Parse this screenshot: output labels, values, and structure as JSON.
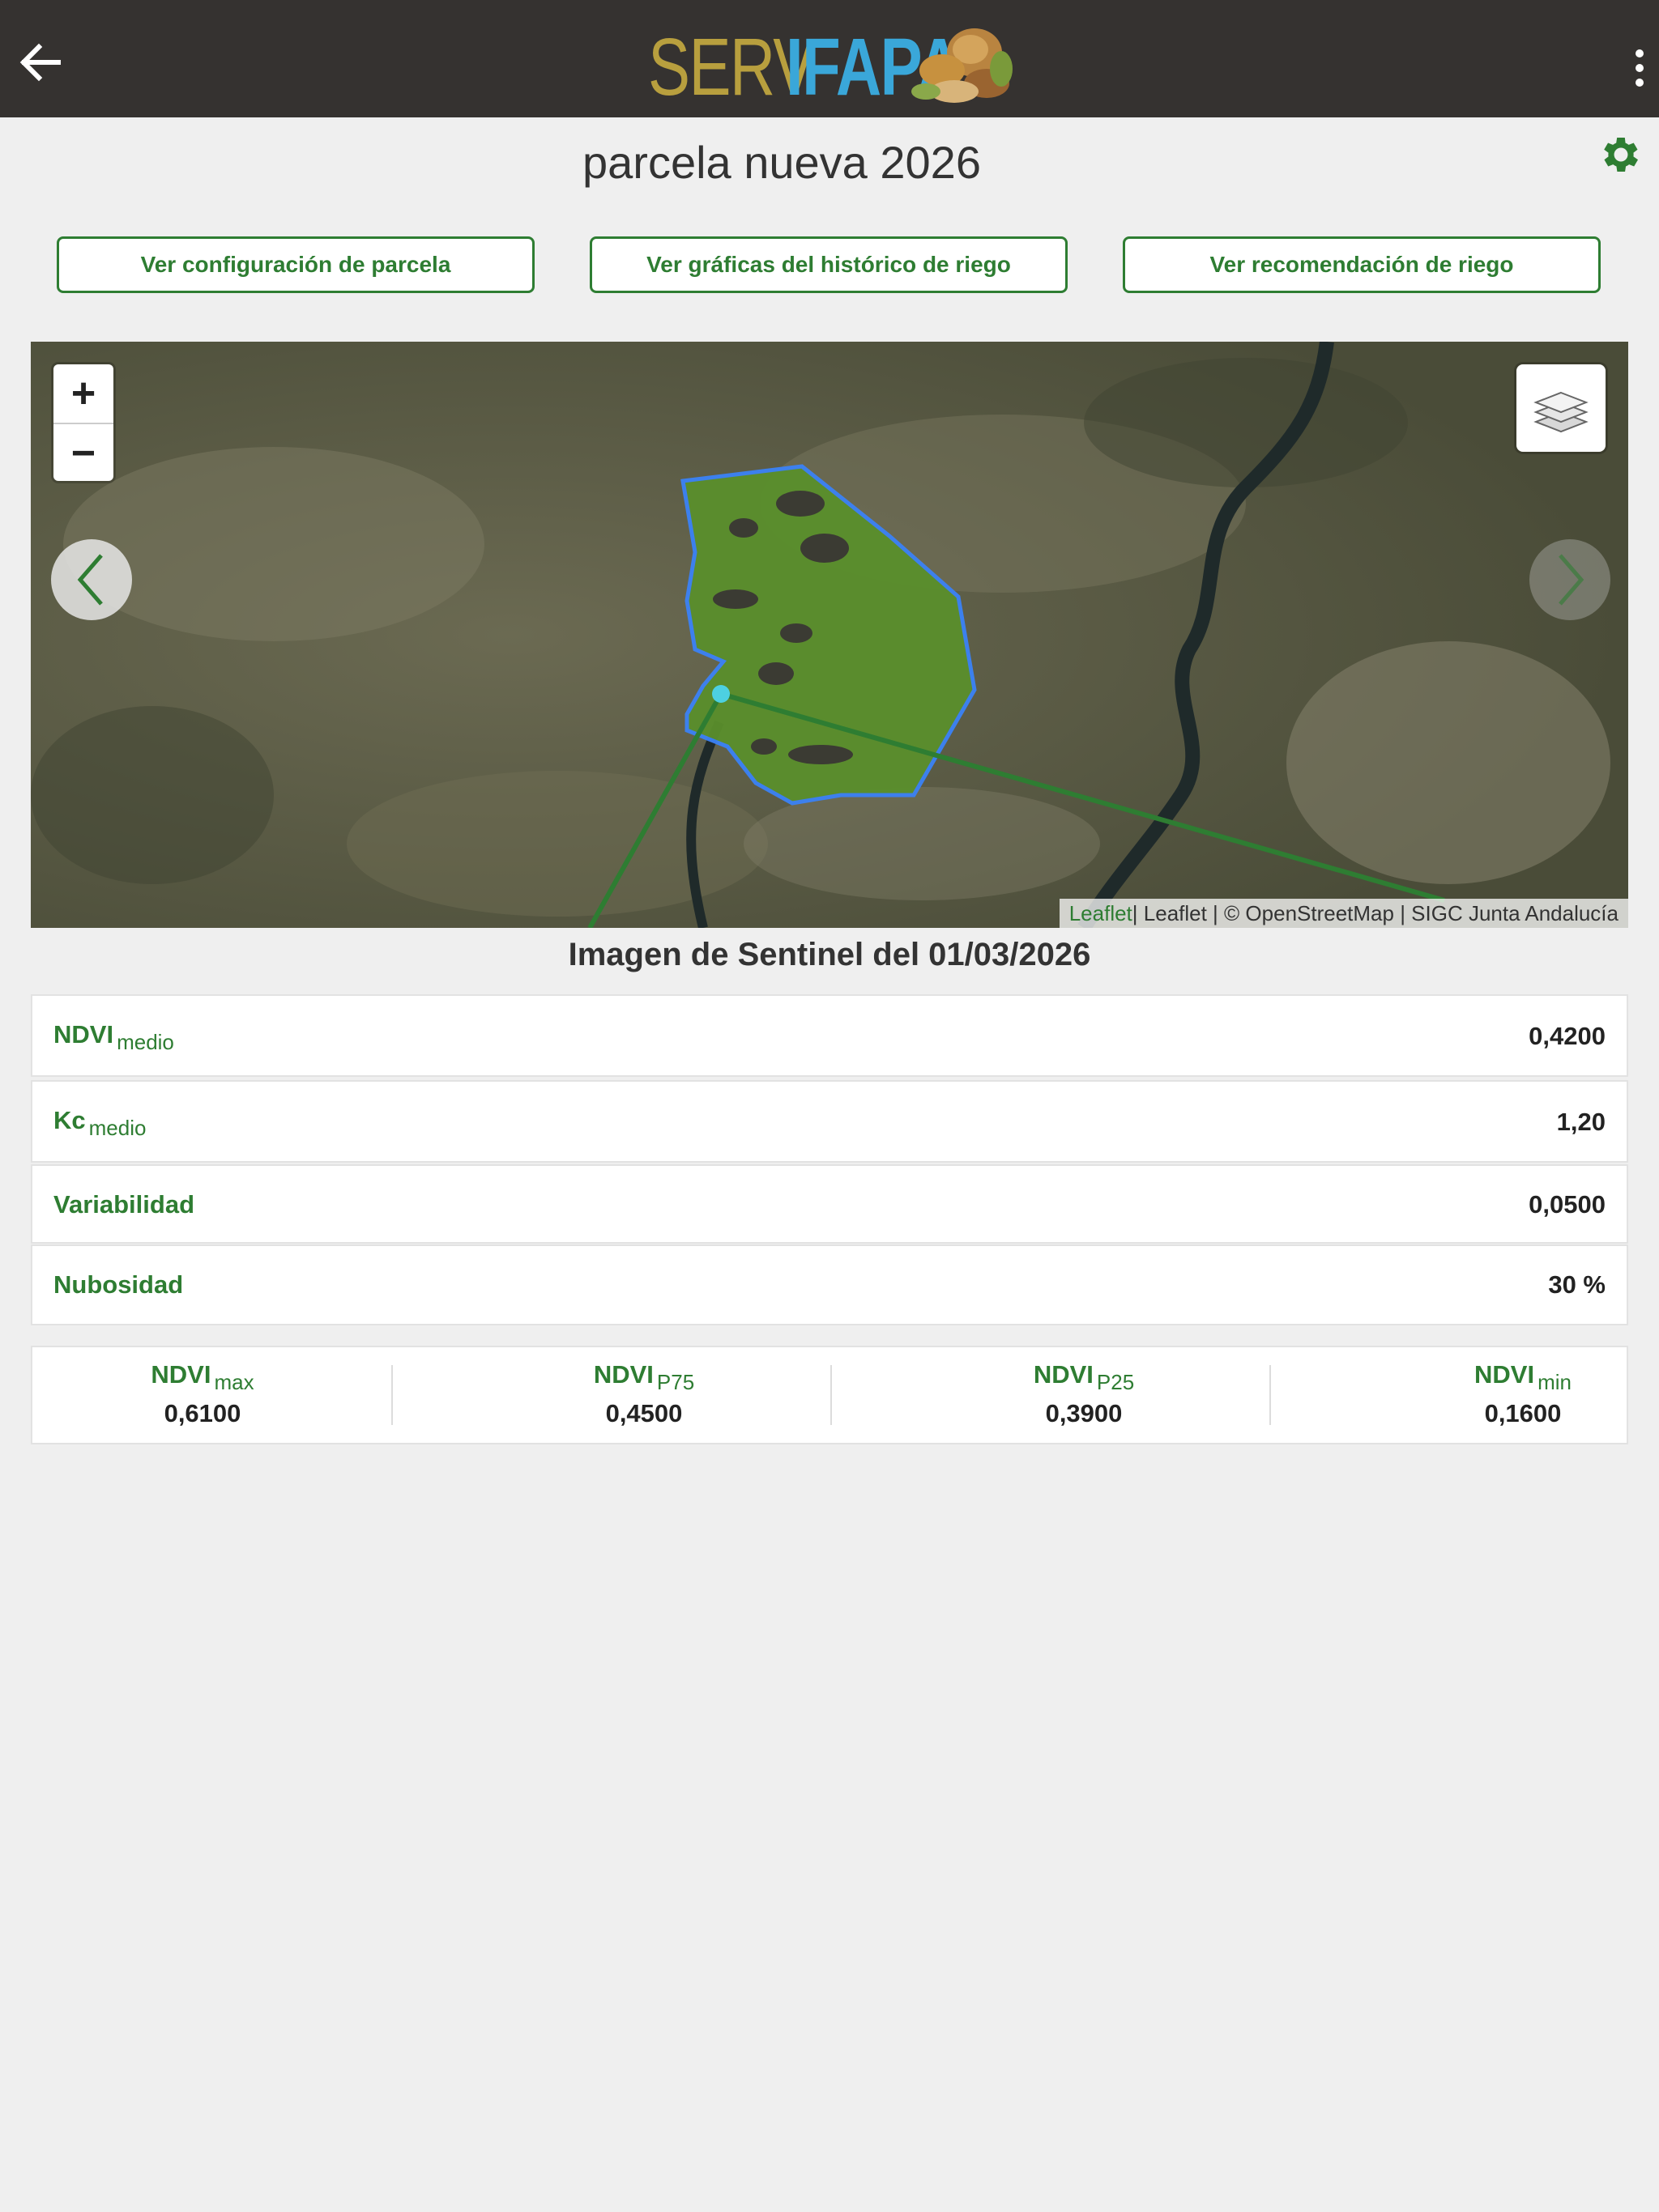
{
  "header": {
    "logo_part1": "SERV",
    "logo_part2": "IFAPA",
    "back_icon": "arrow-left-icon",
    "menu_icon": "more-vertical-icon"
  },
  "parcel": {
    "title": "parcela nueva 2026",
    "settings_icon": "gear-icon"
  },
  "actions": [
    {
      "label": "Ver configuración de parcela"
    },
    {
      "label": "Ver gráficas del histórico de riego"
    },
    {
      "label": "Ver recomendación de riego"
    }
  ],
  "map": {
    "zoom_in": "+",
    "zoom_out": "−",
    "layers_icon": "layers-icon",
    "prev_icon": "chevron-left-icon",
    "next_icon": "chevron-right-icon",
    "attribution_link": "Leaflet",
    "attribution_text": " | Leaflet | © OpenStreetMap | SIGC Junta Andalucía"
  },
  "caption": "Imagen de Sentinel del 01/03/2026",
  "stats": [
    {
      "label": "NDVI",
      "sub": "medio",
      "value": "0,4200"
    },
    {
      "label": "Kc",
      "sub": "medio",
      "value": "1,20"
    },
    {
      "label": "Variabilidad",
      "sub": "",
      "value": "0,0500"
    },
    {
      "label": "Nubosidad",
      "sub": "",
      "value": "30 %"
    }
  ],
  "percentiles": [
    {
      "label": "NDVI",
      "sub": "max",
      "value": "0,6100"
    },
    {
      "label": "NDVI",
      "sub": "P75",
      "value": "0,4500"
    },
    {
      "label": "NDVI",
      "sub": "P25",
      "value": "0,3900"
    },
    {
      "label": "NDVI",
      "sub": "min",
      "value": "0,1600"
    }
  ],
  "colors": {
    "header_bg": "#353230",
    "accent_green": "#2e7d32",
    "logo_gold": "#b89f3e",
    "logo_blue": "#3aa7d9",
    "parcel_outline": "#3b82f6"
  }
}
